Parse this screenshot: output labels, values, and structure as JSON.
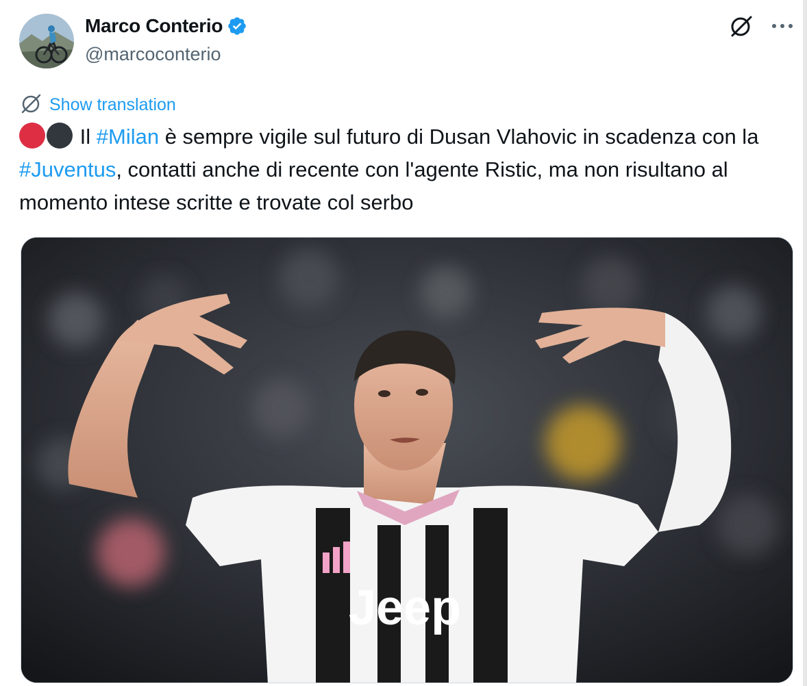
{
  "author": {
    "name": "Marco Conterio",
    "handle": "@marcoconterio",
    "verified": true
  },
  "actions": {
    "grok_icon": "grok-icon",
    "more_icon": "more-icon",
    "more_label": "···"
  },
  "translation": {
    "label": "Show translation",
    "icon": "translate-icon"
  },
  "tweet": {
    "emojis": [
      "red-circle",
      "black-circle"
    ],
    "text_1": "Il ",
    "hashtag_1": "#Milan",
    "text_2": " è sempre vigile sul futuro di Dusan Vlahovic in scadenza con la ",
    "hashtag_2": "#Juventus",
    "text_3": ", contatti anche di recente con l'agente Ristic, ma non risultano al momento intese scritte e trovate col serbo"
  },
  "media": {
    "shirt_sponsor": "Jeep"
  },
  "colors": {
    "accent": "#1d9bf0",
    "verified": "#1d9bf0",
    "text": "#0f1419",
    "muted": "#536471"
  }
}
